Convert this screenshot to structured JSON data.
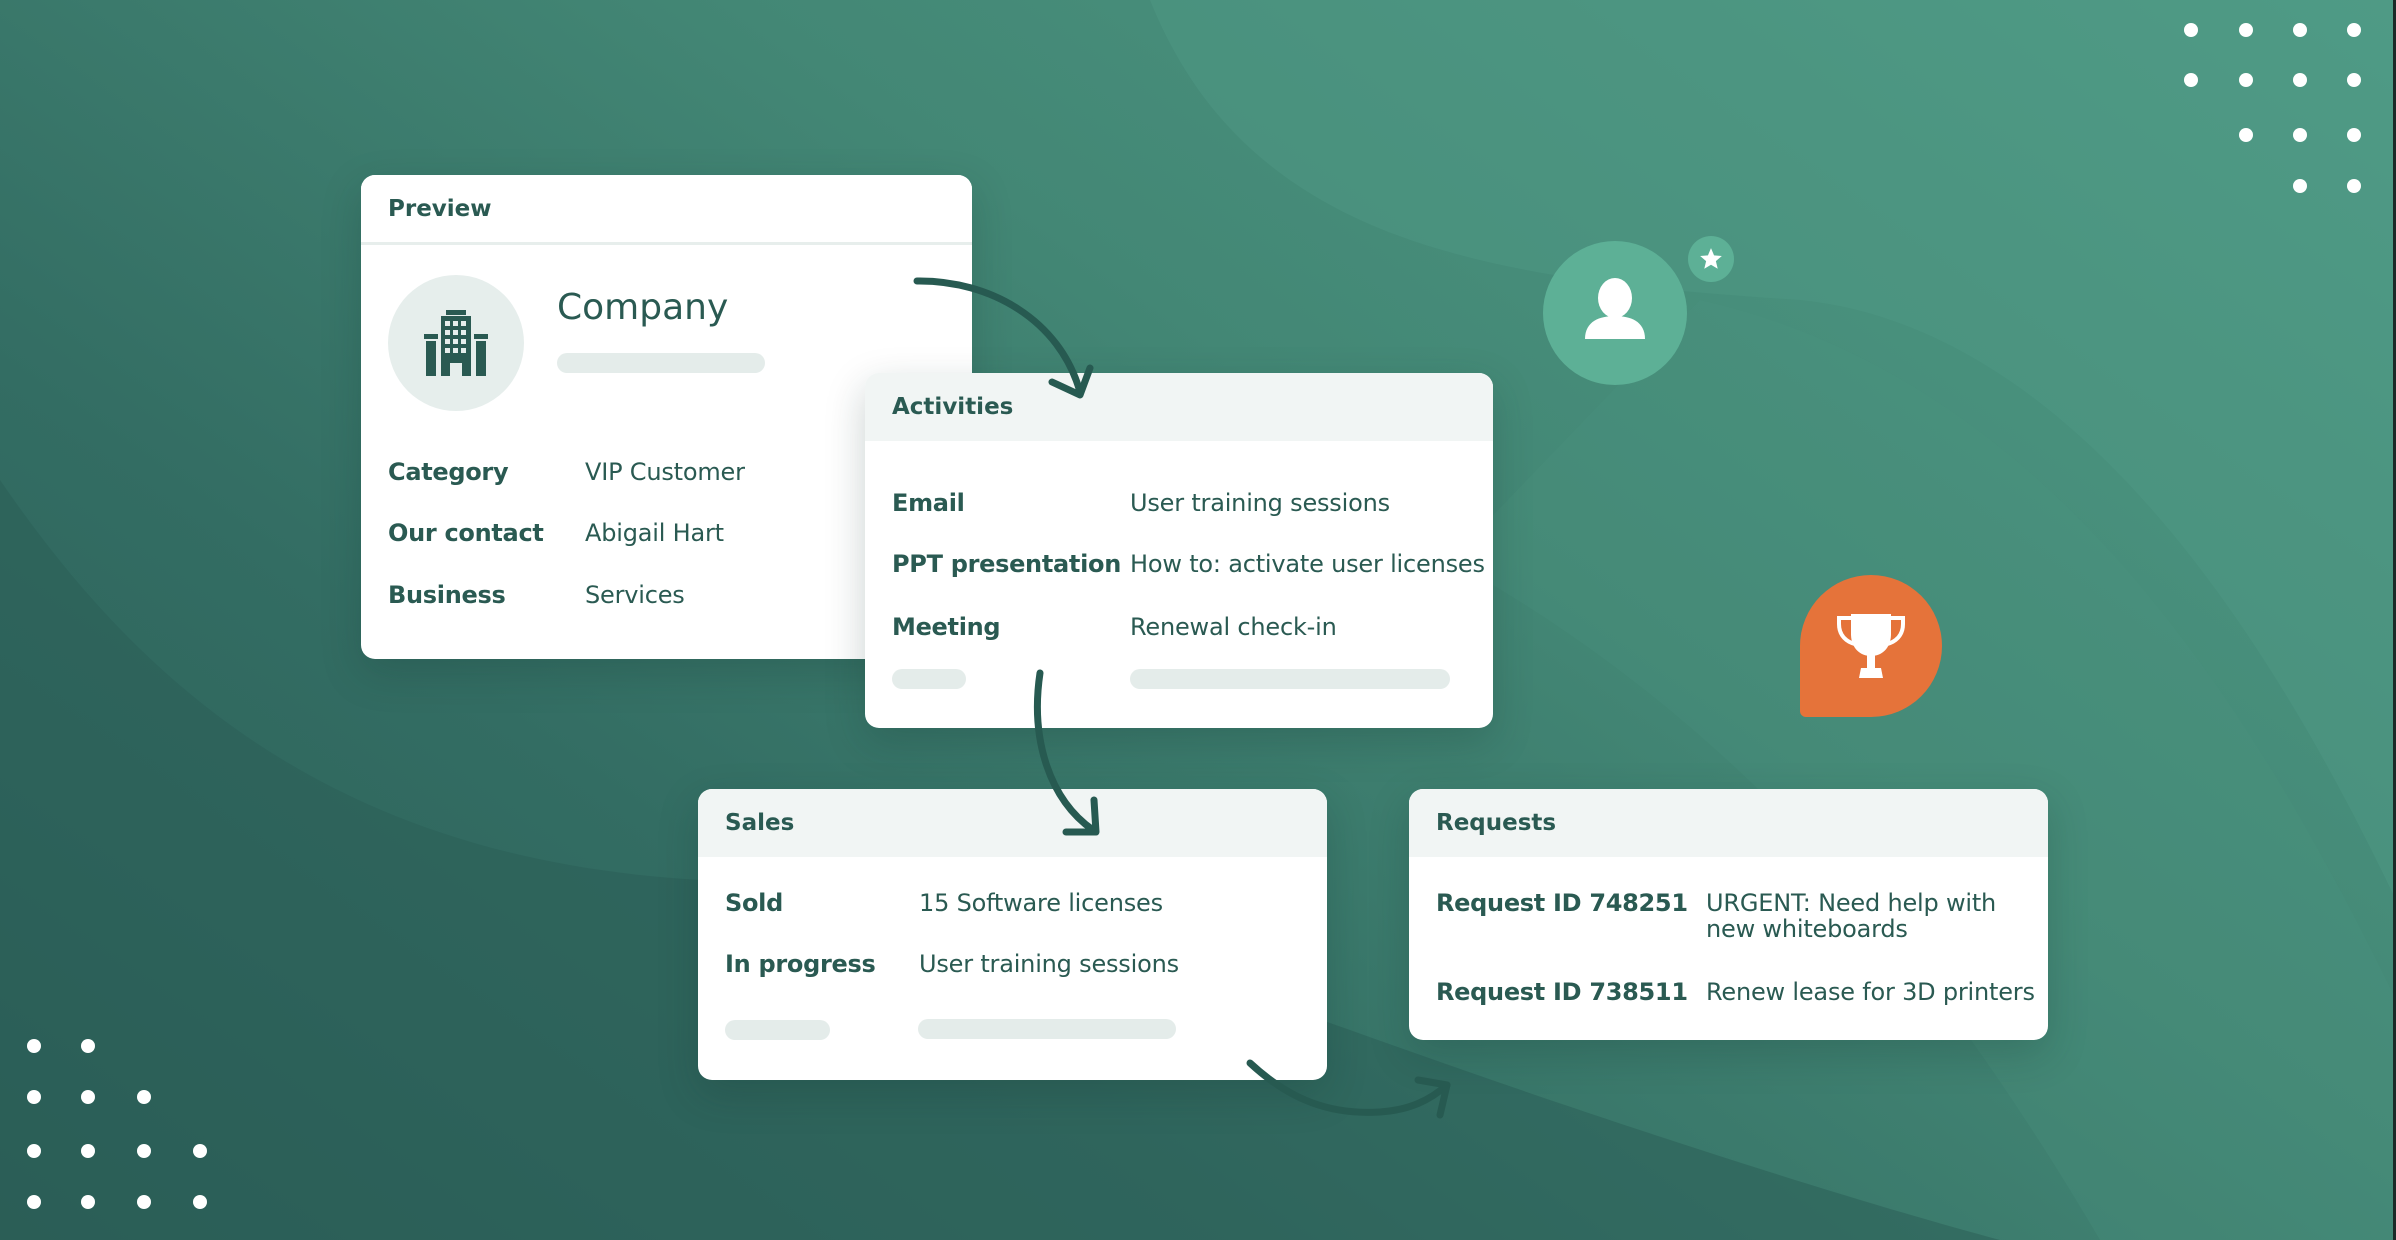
{
  "colors": {
    "text": "#2a5a52",
    "accent_green": "#5db096",
    "accent_orange": "#e5733a",
    "header_band": "#f1f5f4",
    "skeleton": "#e4ecea"
  },
  "preview_card": {
    "title": "Preview",
    "entity_name": "Company",
    "entity_icon": "building-icon",
    "fields": [
      {
        "label": "Category",
        "value": "VIP Customer"
      },
      {
        "label": "Our contact",
        "value": "Abigail Hart"
      },
      {
        "label": "Business",
        "value": "Services"
      }
    ]
  },
  "activities_card": {
    "title": "Activities",
    "items": [
      {
        "type": "Email",
        "subject": "User training sessions"
      },
      {
        "type": "PPT presentation",
        "subject": "How to: activate user licenses"
      },
      {
        "type": "Meeting",
        "subject": "Renewal check-in"
      }
    ]
  },
  "sales_card": {
    "title": "Sales",
    "items": [
      {
        "status": "Sold",
        "detail": "15 Software licenses"
      },
      {
        "status": "In progress",
        "detail": "User training sessions"
      }
    ]
  },
  "requests_card": {
    "title": "Requests",
    "items": [
      {
        "id": "Request ID 748251",
        "description_line1": "URGENT: Need help with",
        "description_line2": "new whiteboards"
      },
      {
        "id": "Request ID 738511",
        "description_line1": "Renew lease for 3D printers"
      }
    ]
  },
  "decorations": {
    "user_badge_icon": "user-icon",
    "star_badge_icon": "star-icon",
    "trophy_badge_icon": "trophy-icon"
  }
}
